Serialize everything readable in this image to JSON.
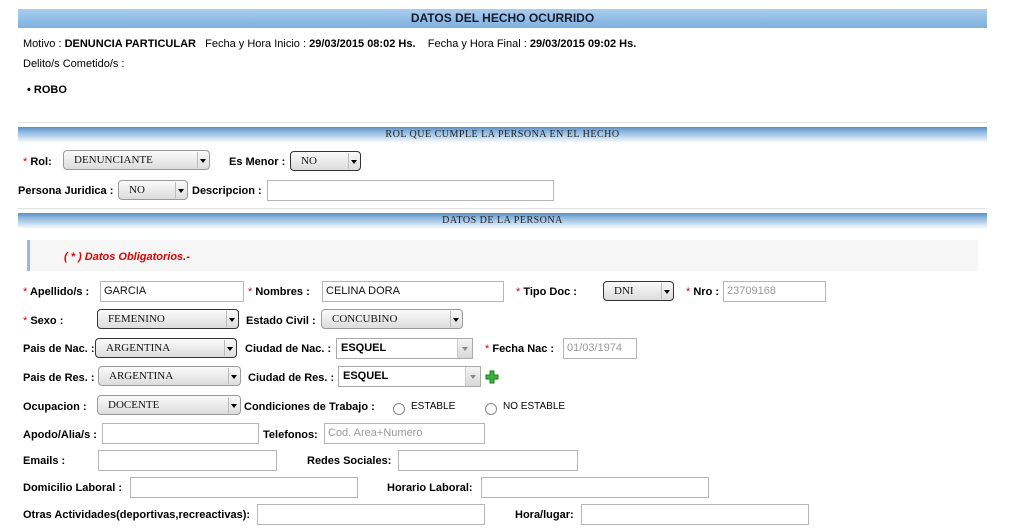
{
  "headers": {
    "hecho": "DATOS DEL HECHO OCURRIDO",
    "rol": "ROL QUE CUMPLE LA PERSONA EN EL HECHO",
    "persona": "DATOS DE LA PERSONA"
  },
  "hecho": {
    "motivo_label": "Motivo :",
    "motivo_value": "DENUNCIA PARTICULAR",
    "fecha_inicio_label": "Fecha y Hora Inicio :",
    "fecha_inicio_value": "29/03/2015 08:02 Hs.",
    "fecha_final_label": "Fecha y Hora Final :",
    "fecha_final_value": "29/03/2015 09:02 Hs.",
    "delitos_label": "Delito/s Cometido/s :",
    "delitos": [
      "ROBO"
    ]
  },
  "rol": {
    "rol_label": "Rol:",
    "rol_value": "DENUNCIANTE",
    "es_menor_label": "Es Menor :",
    "es_menor_value": "NO",
    "persona_juridica_label": "Persona Juridica :",
    "persona_juridica_value": "NO",
    "descripcion_label": "Descripcion :",
    "descripcion_value": ""
  },
  "persona": {
    "notice": "( * ) Datos Obligatorios.-",
    "req_mark": "*",
    "apellidos_label": "Apellido/s :",
    "apellidos_value": "GARCIA",
    "nombres_label": "Nombres :",
    "nombres_value": "CELINA DORA",
    "tipo_doc_label": "Tipo Doc :",
    "tipo_doc_value": "DNI",
    "nro_label": "Nro :",
    "nro_value": "23709168",
    "sexo_label": "Sexo :",
    "sexo_value": "FEMENINO",
    "estado_civil_label": "Estado Civil :",
    "estado_civil_value": "CONCUBINO",
    "pais_nac_label": "Pais de Nac. :",
    "pais_nac_value": "ARGENTINA",
    "ciudad_nac_label": "Ciudad de Nac. :",
    "ciudad_nac_value": "ESQUEL",
    "fecha_nac_label": "Fecha Nac :",
    "fecha_nac_value": "01/03/1974",
    "pais_res_label": "Pais de Res. :",
    "pais_res_value": "ARGENTINA",
    "ciudad_res_label": "Ciudad de Res. :",
    "ciudad_res_value": "ESQUEL",
    "ocupacion_label": "Ocupacion :",
    "ocupacion_value": "DOCENTE",
    "condiciones_label": "Condiciones de Trabajo :",
    "opt_estable": "ESTABLE",
    "opt_no_estable": "NO ESTABLE",
    "apodo_label": "Apodo/Alia/s :",
    "apodo_value": "",
    "telefonos_label": "Telefonos:",
    "telefonos_placeholder": "Cod. Area+Numero",
    "emails_label": "Emails :",
    "emails_value": "",
    "redes_label": "Redes Sociales:",
    "redes_value": "",
    "domicilio_label": "Domicilio Laboral :",
    "domicilio_value": "",
    "horario_label": "Horario Laboral:",
    "horario_value": "",
    "otras_label": "Otras Actividades(deportivas,recreactivas):",
    "otras_value": "",
    "hora_lugar_label": "Hora/lugar:",
    "hora_lugar_value": ""
  },
  "colors": {
    "header_blue": "#7eb1de",
    "required_red": "#e00000",
    "add_green": "#3bb33b"
  }
}
